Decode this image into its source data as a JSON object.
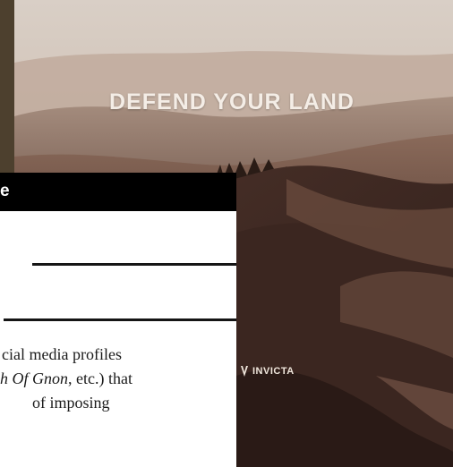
{
  "poster": {
    "headline": "DEFEND YOUR LAND",
    "brand": "INVICTA"
  },
  "card": {
    "header_fragment": "e",
    "body": {
      "line1": "cial media profiles",
      "line2_italic": "h Of Gnon",
      "line2_rest": ", etc.) that",
      "line3": "of imposing"
    }
  },
  "colors": {
    "header_bg": "#000000",
    "text": "#1b1b1b",
    "line": "#151515"
  }
}
